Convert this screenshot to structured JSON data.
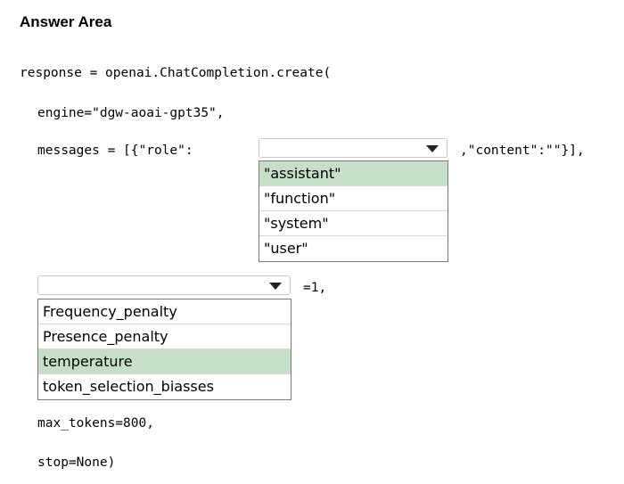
{
  "header": {
    "title": "Answer Area"
  },
  "code": {
    "line1": "response = openai.ChatCompletion.create(",
    "line2": "engine=\"dgw-aoai-gpt35\",",
    "line3_prefix": "messages = [{\"role\":",
    "line3_suffix": ",\"content\":\"\"}],",
    "line4_suffix": "=1,",
    "line5": "max_tokens=800,",
    "line6": "stop=None)"
  },
  "dropdown_role": {
    "value": "",
    "arrow_icon": "chevron-down-icon",
    "options": [
      "\"assistant\"",
      "\"function\"",
      "\"system\"",
      "\"user\""
    ],
    "selected": "\"assistant\""
  },
  "dropdown_param": {
    "value": "",
    "arrow_icon": "chevron-down-icon",
    "options": [
      "Frequency_penalty",
      "Presence_penalty",
      "temperature",
      "token_selection_biasses"
    ],
    "selected": "temperature"
  },
  "colors": {
    "selected_highlight": "#c6e0c7",
    "border": "#7a7a7a"
  }
}
